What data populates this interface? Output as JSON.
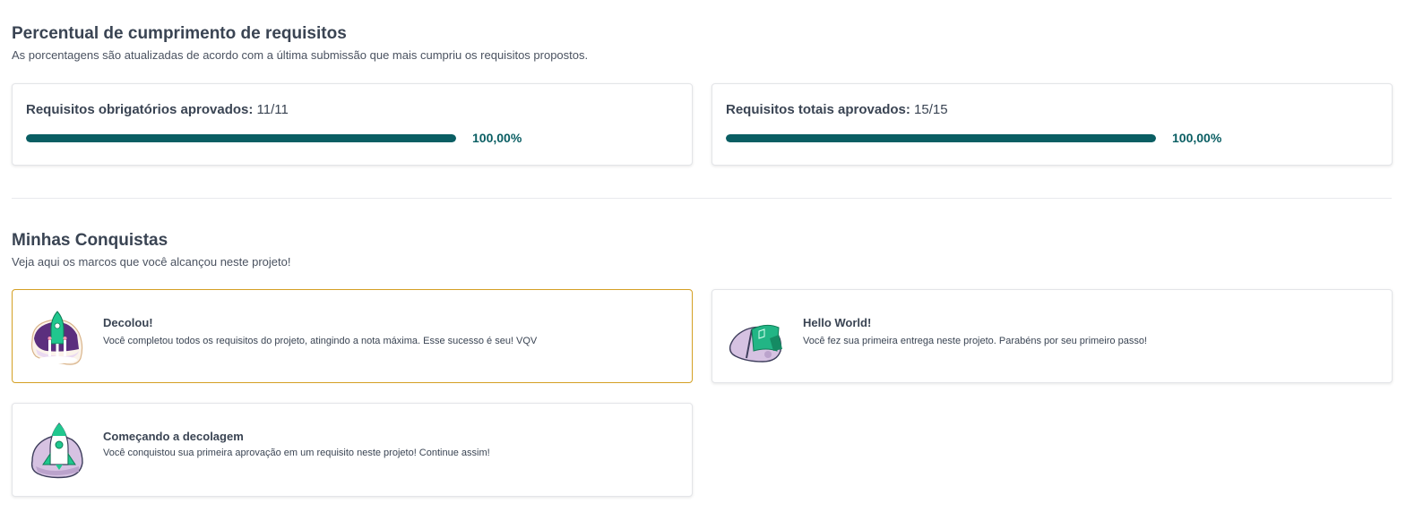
{
  "requirements_section": {
    "title": "Percentual de cumprimento de requisitos",
    "subtitle": "As porcentagens são atualizadas de acordo com a última submissão que mais cumpriu os requisitos propostos.",
    "cards": [
      {
        "label": "Requisitos obrigatórios aprovados:",
        "value": "11/11",
        "percent_text": "100,00%",
        "progress": 1.0
      },
      {
        "label": "Requisitos totais aprovados:",
        "value": "15/15",
        "percent_text": "100,00%",
        "progress": 1.0
      }
    ],
    "progress_color": "#0a5e63"
  },
  "achievements_section": {
    "title": "Minhas Conquistas",
    "subtitle": "Veja aqui os marcos que você alcançou neste projeto!",
    "items": [
      {
        "title": "Decolou!",
        "description": "Você completou todos os requisitos do projeto, atingindo a nota máxima. Esse sucesso é seu! VQV",
        "icon": "rocket-launch-icon",
        "highlighted": true
      },
      {
        "title": "Hello World!",
        "description": "Você fez sua primeira entrega neste projeto. Parabéns por seu primeiro passo!",
        "icon": "flag-icon",
        "highlighted": false
      },
      {
        "title": "Começando a decolagem",
        "description": "Você conquistou sua primeira aprovação em um requisito neste projeto! Continue assim!",
        "icon": "rocket-icon",
        "highlighted": false
      }
    ],
    "highlight_color": "#d4a024"
  }
}
